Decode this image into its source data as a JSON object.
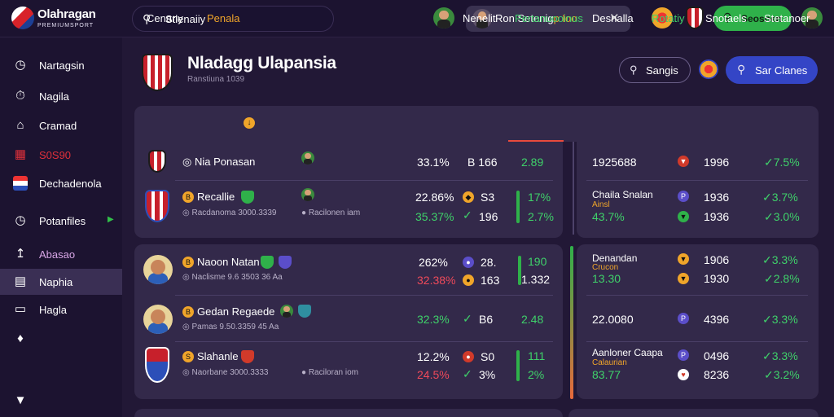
{
  "app": {
    "name": "Olahragan",
    "sub": "PREMIUMSPORT"
  },
  "search": {
    "value": "Stlenaiiy"
  },
  "notice": {
    "text": "Ron Setenig",
    "accent": "p Ioo"
  },
  "header_button": {
    "label": "Seosnen"
  },
  "sidebar": {
    "items": [
      {
        "label": "Nartagsin",
        "icon": "clock-icon"
      },
      {
        "label": "Nagila",
        "icon": "timer-icon"
      },
      {
        "label": "Cramad",
        "icon": "home-icon"
      },
      {
        "label": "S0S90",
        "icon": "calendar-icon"
      },
      {
        "label": "Dechadenola",
        "icon": "flag-icon"
      },
      {
        "label": "Potanfiles",
        "icon": "clock-icon"
      },
      {
        "label": "Abasao",
        "icon": "upload-icon"
      },
      {
        "label": "Naphia",
        "icon": "folder-icon"
      },
      {
        "label": "Hagla",
        "icon": "tv-icon"
      }
    ]
  },
  "page": {
    "title": "Nladagg Ulapansia",
    "subtitle": "Ranstiuna 1039"
  },
  "actions": {
    "search_label": "Sangis",
    "primary_label": "Sar Clanes"
  },
  "tabs": [
    "Cenany",
    "Penala",
    "Nenelit",
    "Pertanuooinus",
    "Desnalla",
    "Rotatiy",
    "Snotaels",
    "Stetanoer"
  ],
  "rows": [
    {
      "name": "Nia Ponasan",
      "sub": "",
      "pct1": "33.1%",
      "pct2": "",
      "val1": "B 166",
      "val2": "",
      "v3": "2.89",
      "v4": ""
    },
    {
      "name": "Recallie",
      "sub": "Racdanoma 3000.3339",
      "sub2": "Racilonen iam",
      "pct1": "22.86%",
      "pct2": "35.37%",
      "val1": "S3",
      "val2": "196",
      "v3": "17%",
      "v4": "2.7%"
    },
    {
      "name": "Naoon Natan",
      "sub": "Naclisme 9.6 3503 36 Aa",
      "pct1": "262%",
      "pct2": "32.38%",
      "val1": "28.",
      "val2": "163",
      "v3": "190",
      "v4": "1.332"
    },
    {
      "name": "Gedan Regaede",
      "sub": "Pamas 9.50.3359 45 Aa",
      "pct1": "32.3%",
      "pct2": "",
      "val1": "B6",
      "val2": "",
      "v3": "2.48",
      "v4": ""
    },
    {
      "name": "Slahanle",
      "sub": "Naorbane 3000.3333",
      "sub2": "Raciloran iom",
      "pct1": "12.2%",
      "pct2": "24.5%",
      "val1": "S0",
      "val2": "3%",
      "v3": "111",
      "v4": "2%"
    }
  ],
  "right_rows": [
    {
      "label": "1925688",
      "sub": "",
      "val": "1996",
      "chg": "7.5%"
    },
    {
      "label": "Chaila Snalan",
      "sub": "Ainsl",
      "pct": "43.7%",
      "val": "1936",
      "val2": "1936",
      "chg": "3.7%",
      "chg2": "3.0%"
    },
    {
      "label": "Denandan",
      "sub": "Crucon",
      "pct": "13.30",
      "val": "1906",
      "val2": "1930",
      "chg": "3.3%",
      "chg2": "2.8%"
    },
    {
      "label": "22.0080",
      "sub": "",
      "val": "4396",
      "chg": "3.3%"
    },
    {
      "label": "Aanloner Caapa",
      "sub": "Calaurian",
      "pct": "83.77",
      "val": "0496",
      "val2": "8236",
      "chg": "3.3%",
      "chg2": "3.2%"
    }
  ],
  "colors": {
    "accent_green": "#3fd16a",
    "accent_orange": "#f0a52a",
    "accent_red": "#ef4a5a",
    "primary_blue": "#3445c6"
  }
}
